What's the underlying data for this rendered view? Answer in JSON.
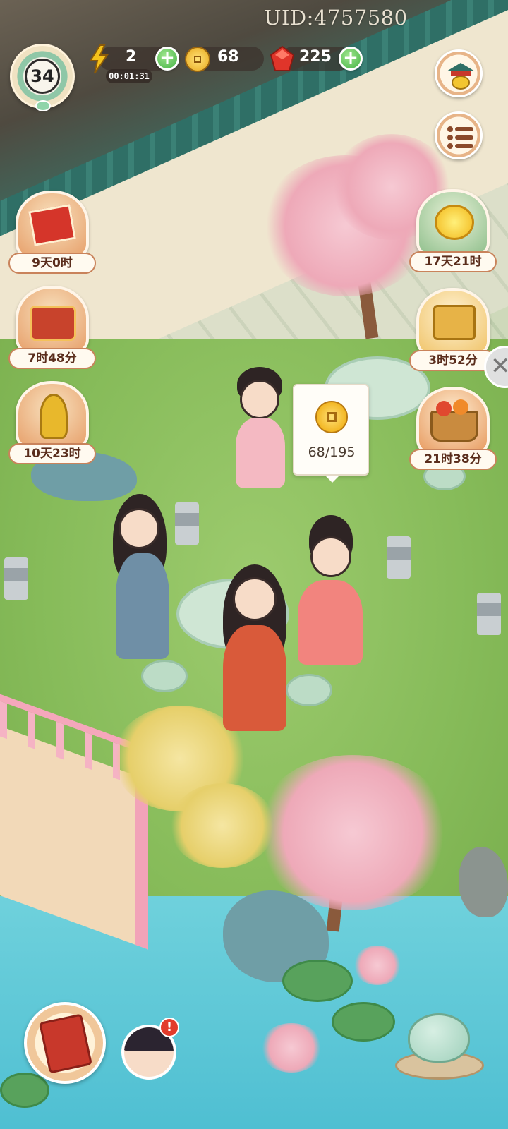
{
  "hud": {
    "uid": "UID:4757580",
    "level": "34",
    "energy": {
      "value": "2",
      "timer": "00:01:31"
    },
    "coins": {
      "value": "68"
    },
    "gems": {
      "value": "225"
    },
    "plus_label": "+"
  },
  "events": [
    {
      "name": "fortune-envelope-event",
      "timer": "9天0时"
    },
    {
      "name": "treasure-chest-event",
      "timer": "7时48分"
    },
    {
      "name": "wheat-harvest-event",
      "timer": "10天23时"
    },
    {
      "name": "chrysanthemum-event",
      "timer": "17天21时"
    },
    {
      "name": "mooncake-event",
      "timer": "3时52分"
    },
    {
      "name": "fruit-basket-event",
      "timer": "21时38分"
    }
  ],
  "coin_bubble": {
    "text": "68/195"
  },
  "bottom": {
    "alert_mark": "!"
  },
  "icons": {
    "energy": "lightning-icon",
    "coin": "coin-icon",
    "gem": "red-gem-icon",
    "pavilion": "pavilion-icon",
    "menu": "list-menu-icon",
    "close": "close-icon",
    "book": "book-icon",
    "teapot": "teapot-icon"
  },
  "colors": {
    "plus_green": "#45b345",
    "timer_border": "#c9835b",
    "alert_red": "#e23b2b"
  }
}
